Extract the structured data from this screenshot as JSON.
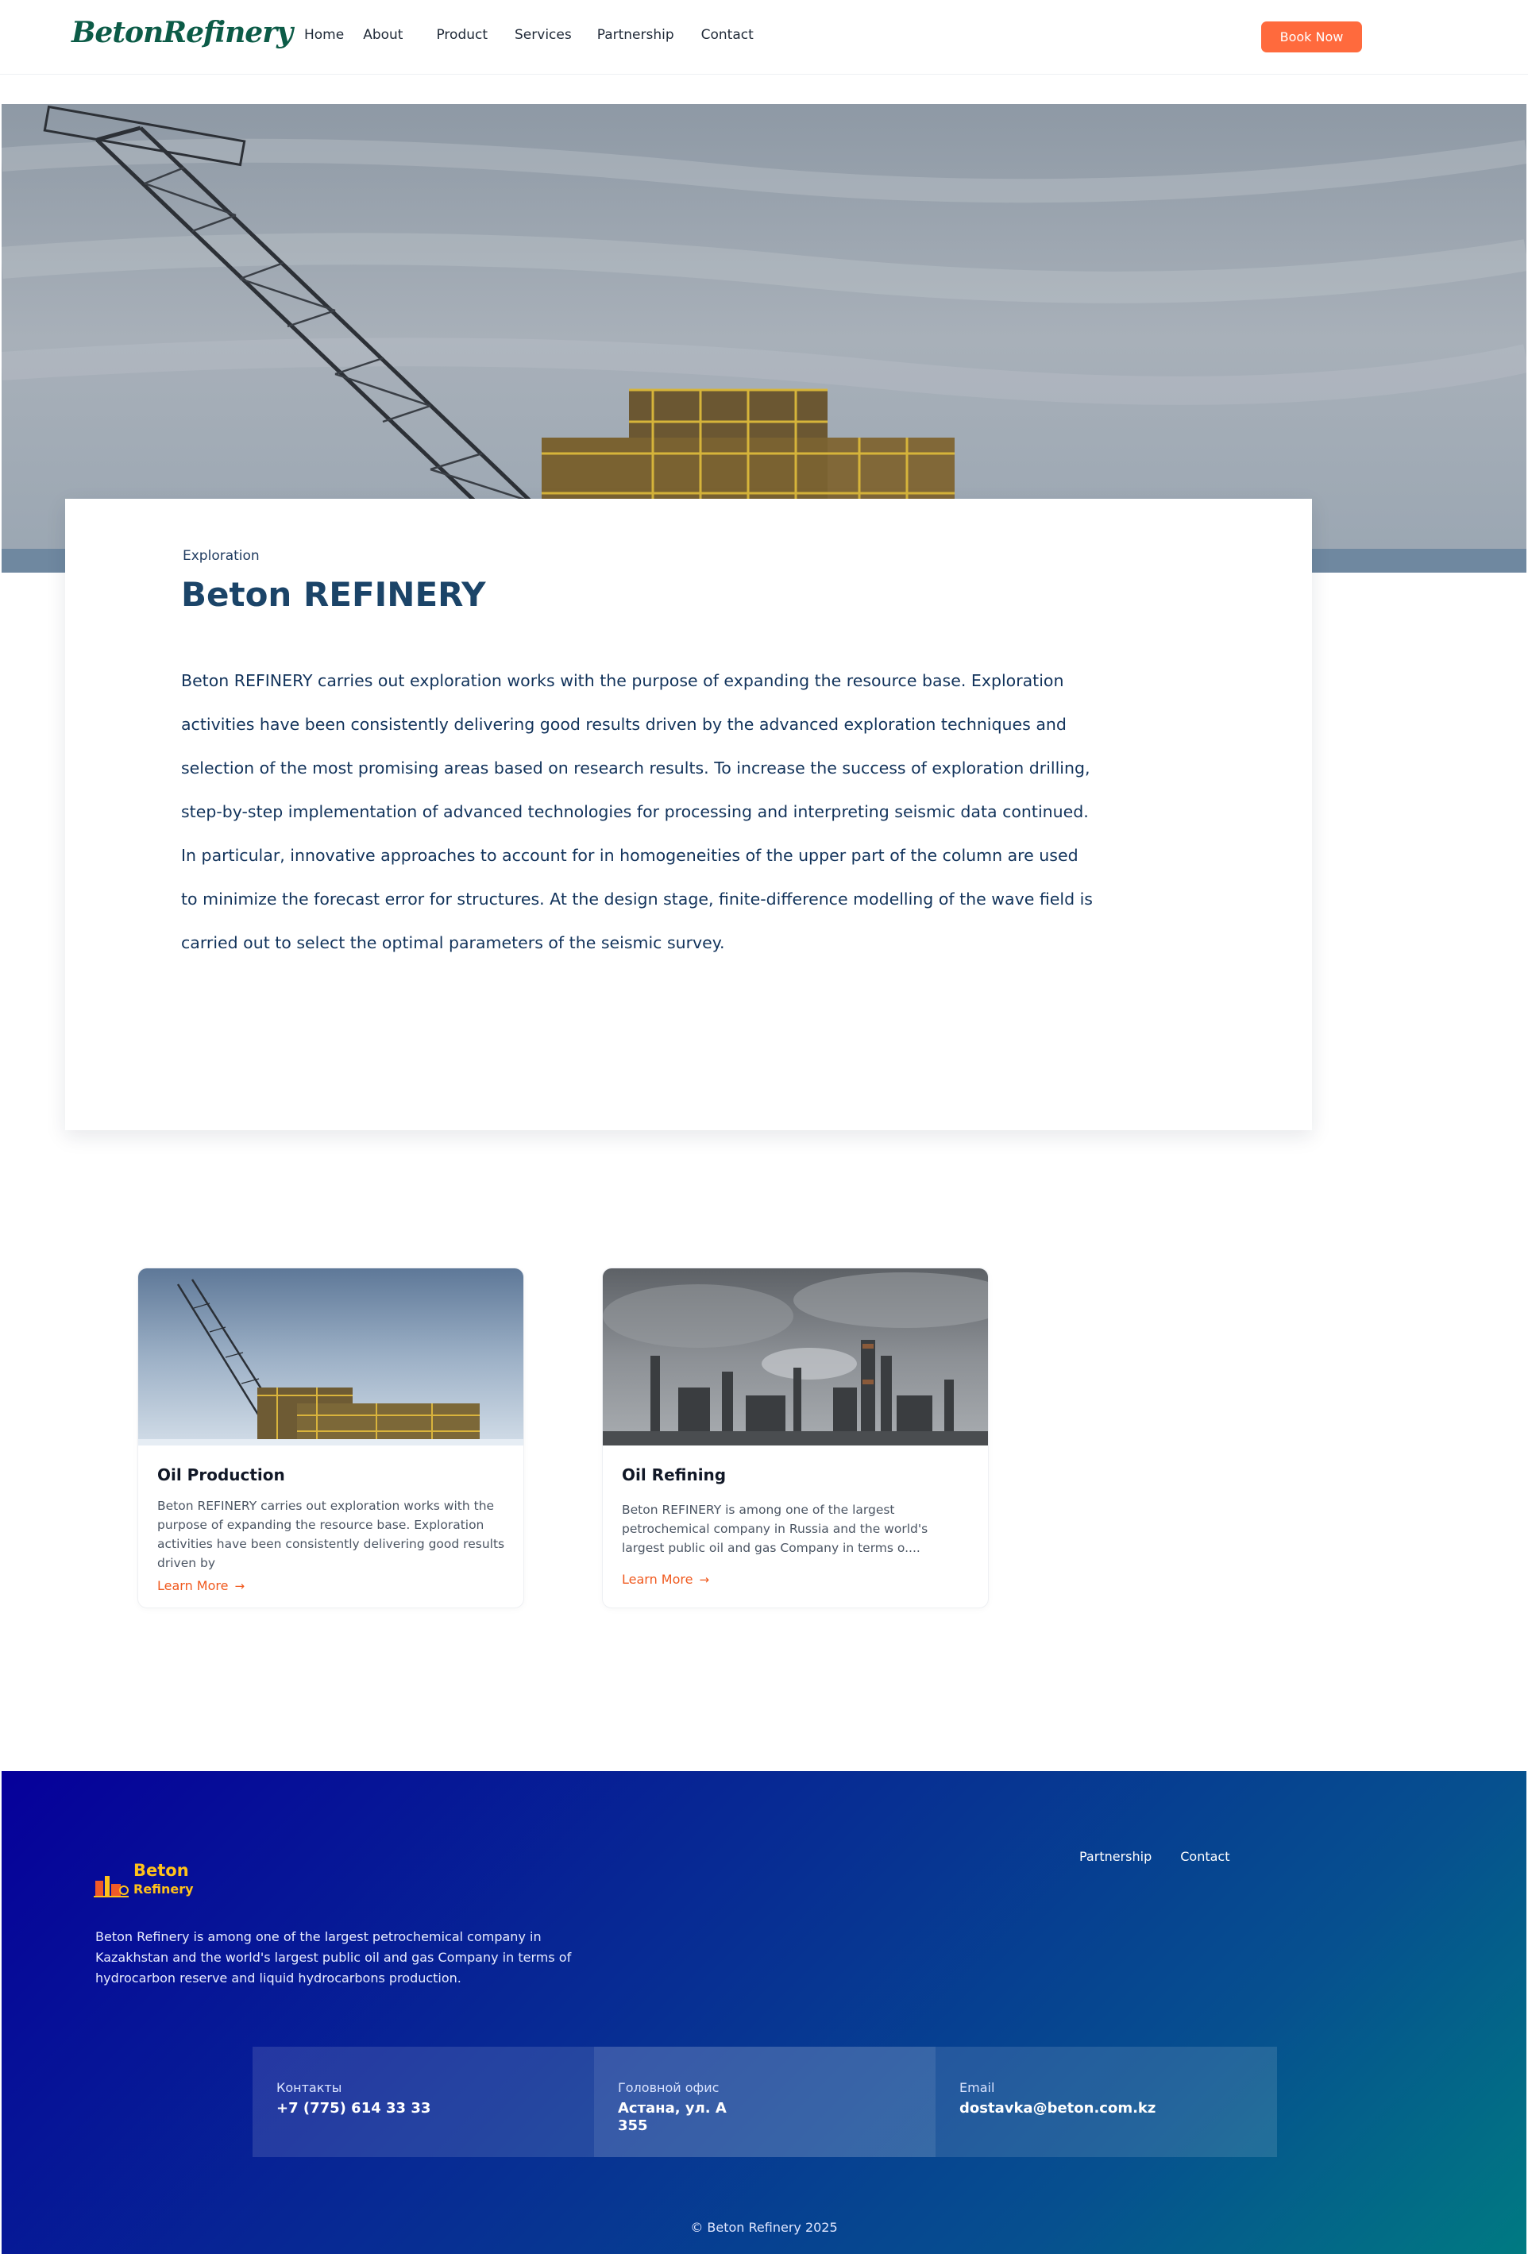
{
  "header": {
    "logo": "BetonRefinery",
    "nav": [
      "Home",
      "About",
      "Product",
      "Services",
      "Partnership",
      "Contact"
    ],
    "cta": "Book Now"
  },
  "hero": {
    "image": "offshore-drilling-rig-photo"
  },
  "intro": {
    "eyebrow": "Exploration",
    "title": "Beton REFINERY",
    "body": "Beton REFINERY carries out exploration works with the purpose of expanding the resource base. Exploration activities have been consistently delivering good results driven by the advanced exploration techniques and selection of the most promising areas based on research results. To increase the success of exploration drilling, step-by-step implementation of advanced technologies for processing and interpreting seismic data continued. In particular, innovative approaches to account for in homogeneities of the upper part of the column are used to minimize the forecast error for structures. At the design stage, finite-difference modelling of the wave field is carried out to select the optimal parameters of the seismic survey."
  },
  "services": [
    {
      "title": "Oil Production",
      "text": "Beton REFINERY carries out exploration works with the purpose of expanding the resource base. Exploration activities have been consistently delivering good results driven by",
      "link": "Learn More",
      "arrow": "→"
    },
    {
      "title": "Oil Refining",
      "text": "Beton REFINERY is among one of the largest petrochemical company in Russia and the world's largest public oil and gas Company in terms o....",
      "link": "Learn More",
      "arrow": "→"
    }
  ],
  "footer": {
    "brand_line1": "Beton",
    "brand_line2": "Refinery",
    "description": "Beton Refinery is among one of the largest petrochemical company in Kazakhstan and the world's largest public oil and gas Company in terms of hydrocarbon reserve and liquid hydrocarbons production.",
    "links": [
      "Partnership",
      "Contact"
    ],
    "contacts": [
      {
        "label": "Контакты",
        "value": "+7 (775) 614 33 33"
      },
      {
        "label": "Головной офис",
        "value": "Астана, ул. А 355"
      },
      {
        "label": "Email",
        "value": "dostavka@beton.com.kz"
      }
    ],
    "copyright": "© Beton Refinery 2025"
  },
  "colors": {
    "accent": "#ff6a3d",
    "title": "#1b4468",
    "footer_start": "#06009a",
    "footer_end": "#007a82",
    "brand_yellow": "#ffc21a"
  }
}
